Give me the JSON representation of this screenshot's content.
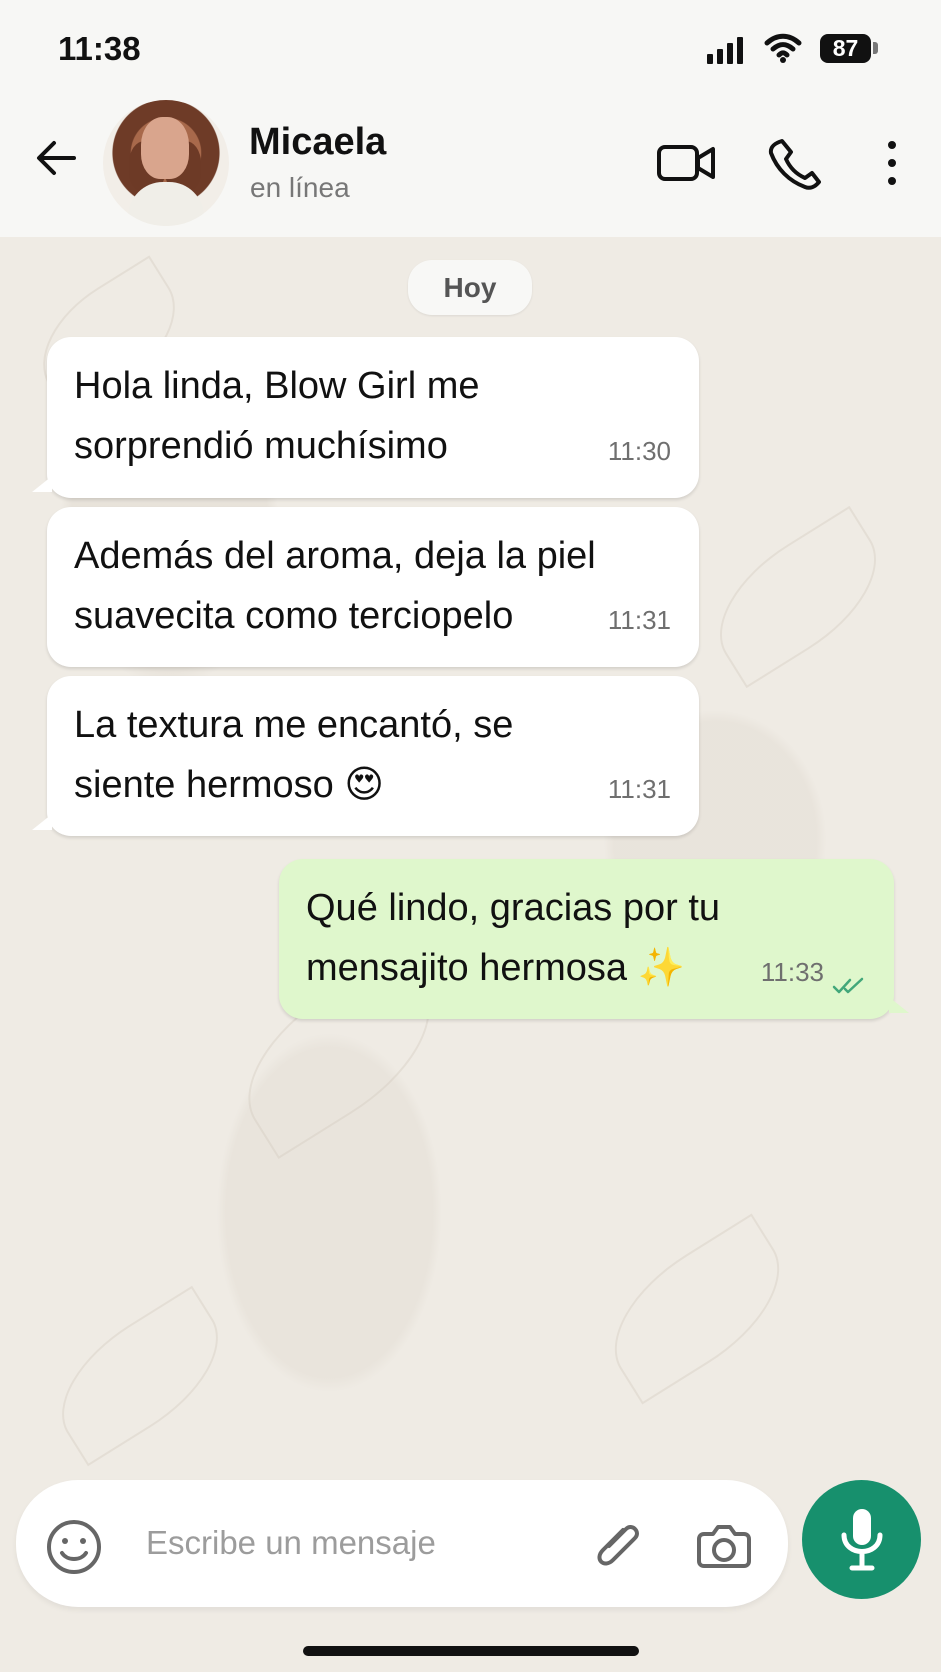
{
  "status": {
    "time": "11:38",
    "battery": "87"
  },
  "header": {
    "name": "Micaela",
    "presence": "en línea",
    "icons": [
      "back-arrow-icon",
      "avatar",
      "video-icon",
      "phone-icon",
      "more-icon"
    ]
  },
  "date_separator": "Hoy",
  "messages": [
    {
      "direction": "incoming",
      "text": "Hola linda, Blow Girl me\nsorprendió muchísimo",
      "time": "11:30"
    },
    {
      "direction": "incoming",
      "text": "Además del aroma, deja la piel\nsuavecita como terciopelo",
      "time": "11:31"
    },
    {
      "direction": "incoming",
      "text": "La textura me encantó, se\nsiente hermoso 😍",
      "time": "11:31"
    },
    {
      "direction": "outgoing",
      "text": "Qué lindo, gracias por tu\nmensajito hermosa ✨",
      "time": "11:33",
      "status_icon": "double-check-icon"
    }
  ],
  "composer": {
    "placeholder": "Escribe un mensaje",
    "icons": [
      "emoji-icon",
      "attach-icon",
      "camera-icon",
      "mic-icon"
    ]
  },
  "colors": {
    "accent": "#17906d",
    "outgoing_bubble": "#dff7cc",
    "incoming_bubble": "#ffffff",
    "chat_background": "#efebe4"
  }
}
